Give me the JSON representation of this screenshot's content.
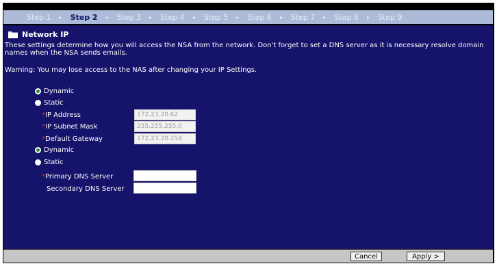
{
  "wizard": {
    "steps": [
      {
        "label": "Step 1",
        "active": false
      },
      {
        "label": "Step 2",
        "active": true
      },
      {
        "label": "Step 3",
        "active": false
      },
      {
        "label": "Step 4",
        "active": false
      },
      {
        "label": "Step 5",
        "active": false
      },
      {
        "label": "Step 6",
        "active": false
      },
      {
        "label": "Step 7",
        "active": false
      },
      {
        "label": "Step 8",
        "active": false
      },
      {
        "label": "Step 9",
        "active": false
      }
    ]
  },
  "page": {
    "title": "Network IP",
    "description": "These settings determine how you will access the NSA from the network. Don't forget to set a DNS server as it is necessary resolve domain names when the NSA sends emails.",
    "warning": "Warning: You may lose access to the NAS after changing your IP Settings."
  },
  "ip": {
    "dynamic_label": "Dynamic",
    "static_label": "Static",
    "selected": "Dynamic",
    "fields": {
      "ip_address": {
        "label": "IP Address",
        "value": "172.23.20.62",
        "required": true
      },
      "subnet_mask": {
        "label": "IP Subnet Mask",
        "value": "255.255.255.0",
        "required": true
      },
      "gateway": {
        "label": "Default Gateway",
        "value": "172.23.20.254",
        "required": true
      }
    }
  },
  "dns": {
    "dynamic_label": "Dynamic",
    "static_label": "Static",
    "selected": "Dynamic",
    "fields": {
      "primary": {
        "label": "Primary DNS Server",
        "value": "",
        "required": true
      },
      "secondary": {
        "label": "Secondary DNS Server",
        "value": "",
        "required": false
      }
    }
  },
  "buttons": {
    "cancel": "Cancel",
    "apply": "Apply >"
  },
  "required_marker": "*",
  "colors": {
    "panel_bg": "#15136a",
    "stepbar_bg": "#adbbd8",
    "active_step": "#0b1a6a",
    "required": "#d93030"
  }
}
